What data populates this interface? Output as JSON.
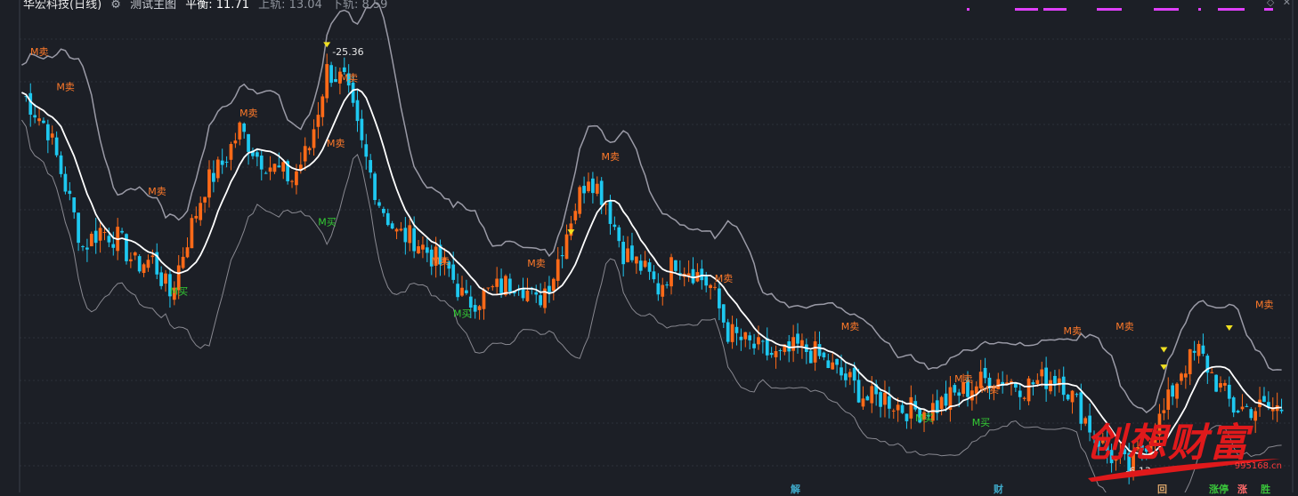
{
  "header": {
    "stock_name": "华宏科技(日线)",
    "gear_icon": "gear-icon",
    "indicator_name": "测试主图",
    "mid_label": "平衡: 11.71",
    "upper_label": "上轨: 13.04",
    "lower_label": "下轨: 8.59"
  },
  "top_right_icons": [
    "diamond-icon",
    "close-icon"
  ],
  "watermark": {
    "text": "创想财富",
    "url": "995168.cn"
  },
  "footer_markers": [
    {
      "label": "解",
      "color": "#3fa9c9"
    },
    {
      "label": "财",
      "color": "#3fa9c9"
    },
    {
      "label": "回",
      "color": "#d9a46a"
    },
    {
      "label": "涨停",
      "color": "#39c33a"
    },
    {
      "label": "涨",
      "color": "#ff6a6a"
    },
    {
      "label": "胜",
      "color": "#39c33a"
    }
  ],
  "colors": {
    "background": "#1c1f26",
    "up_candle": "#ff6a18",
    "down_candle": "#1ec8f0",
    "mid_line": "#ffffff",
    "upper_band": "#9a9aa6",
    "lower_band": "#888890",
    "sell_label": "#ff7a2a",
    "buy_label": "#33cc33",
    "marker": "#f0e020",
    "grid": "#2c313b",
    "magenta_bar": "#e040fb",
    "watermark": "#e0191b"
  },
  "chart_data": {
    "type": "candlestick",
    "y_range": [
      5.5,
      27.0
    ],
    "bars": 205,
    "price_path": [
      [
        0,
        23.5
      ],
      [
        6,
        21.8
      ],
      [
        10,
        19.2
      ],
      [
        14,
        16.4
      ],
      [
        18,
        17.2
      ],
      [
        22,
        16.8
      ],
      [
        26,
        15.6
      ],
      [
        30,
        15.8
      ],
      [
        34,
        14.2
      ],
      [
        38,
        16.8
      ],
      [
        42,
        19.2
      ],
      [
        46,
        20.2
      ],
      [
        50,
        21.8
      ],
      [
        54,
        20.6
      ],
      [
        58,
        20.0
      ],
      [
        62,
        19.5
      ],
      [
        66,
        21.0
      ],
      [
        70,
        24.5
      ],
      [
        74,
        24.0
      ],
      [
        78,
        21.0
      ],
      [
        82,
        18.5
      ],
      [
        86,
        17.0
      ],
      [
        90,
        16.8
      ],
      [
        94,
        16.0
      ],
      [
        98,
        15.3
      ],
      [
        102,
        13.8
      ],
      [
        106,
        14.2
      ],
      [
        110,
        14.6
      ],
      [
        114,
        14.9
      ],
      [
        118,
        13.8
      ],
      [
        122,
        15.2
      ],
      [
        126,
        17.8
      ],
      [
        130,
        19.8
      ],
      [
        134,
        18.5
      ],
      [
        138,
        16.2
      ],
      [
        142,
        15.5
      ],
      [
        146,
        14.5
      ],
      [
        150,
        15.8
      ],
      [
        154,
        15.3
      ],
      [
        158,
        14.6
      ],
      [
        162,
        12.5
      ],
      [
        166,
        12.0
      ],
      [
        170,
        11.6
      ],
      [
        174,
        11.3
      ],
      [
        178,
        11.8
      ],
      [
        182,
        11.5
      ],
      [
        186,
        10.8
      ],
      [
        190,
        10.2
      ],
      [
        194,
        9.4
      ],
      [
        198,
        9.5
      ],
      [
        202,
        9.0
      ],
      [
        206,
        8.9
      ],
      [
        210,
        9.1
      ],
      [
        214,
        9.6
      ],
      [
        218,
        10.0
      ],
      [
        222,
        10.4
      ],
      [
        226,
        10.3
      ],
      [
        230,
        10.0
      ],
      [
        234,
        10.3
      ],
      [
        238,
        10.5
      ],
      [
        242,
        9.2
      ],
      [
        246,
        7.8
      ],
      [
        250,
        6.8
      ],
      [
        254,
        6.2
      ],
      [
        258,
        7.5
      ],
      [
        262,
        8.8
      ],
      [
        266,
        10.8
      ],
      [
        270,
        11.6
      ],
      [
        274,
        10.2
      ],
      [
        278,
        9.0
      ]
    ],
    "price_marks": [
      {
        "bar": 70,
        "price": 25.36,
        "label": "25.36"
      },
      {
        "bar": 252,
        "price": 6.13,
        "label": "6.13"
      }
    ],
    "signals": [
      {
        "bar": 4,
        "price": 25.2,
        "label": "M卖",
        "kind": "sell"
      },
      {
        "bar": 10,
        "price": 23.6,
        "label": "M卖",
        "kind": "sell"
      },
      {
        "bar": 31,
        "price": 18.8,
        "label": "M卖",
        "kind": "sell"
      },
      {
        "bar": 52,
        "price": 22.4,
        "label": "M卖",
        "kind": "sell"
      },
      {
        "bar": 75,
        "price": 24.0,
        "label": "M卖",
        "kind": "sell"
      },
      {
        "bar": 72,
        "price": 21.0,
        "label": "M卖",
        "kind": "sell"
      },
      {
        "bar": 96,
        "price": 15.6,
        "label": "M卖",
        "kind": "sell"
      },
      {
        "bar": 118,
        "price": 15.5,
        "label": "M卖",
        "kind": "sell"
      },
      {
        "bar": 135,
        "price": 20.4,
        "label": "M卖",
        "kind": "sell"
      },
      {
        "bar": 161,
        "price": 14.8,
        "label": "M卖",
        "kind": "sell"
      },
      {
        "bar": 190,
        "price": 12.6,
        "label": "M卖",
        "kind": "sell"
      },
      {
        "bar": 241,
        "price": 12.4,
        "label": "M卖",
        "kind": "sell"
      },
      {
        "bar": 253,
        "price": 12.6,
        "label": "M卖",
        "kind": "sell"
      },
      {
        "bar": 216,
        "price": 10.2,
        "label": "M卖",
        "kind": "sell"
      },
      {
        "bar": 222,
        "price": 9.7,
        "label": "M卖",
        "kind": "sell"
      },
      {
        "bar": 285,
        "price": 13.6,
        "label": "M卖",
        "kind": "sell"
      },
      {
        "bar": 70,
        "price": 17.4,
        "label": "M买",
        "kind": "buy"
      },
      {
        "bar": 36,
        "price": 14.2,
        "label": "M买",
        "kind": "buy"
      },
      {
        "bar": 101,
        "price": 13.2,
        "label": "M买",
        "kind": "buy"
      },
      {
        "bar": 207,
        "price": 8.4,
        "label": "M买",
        "kind": "buy"
      },
      {
        "bar": 220,
        "price": 8.2,
        "label": "M买",
        "kind": "buy"
      }
    ]
  }
}
